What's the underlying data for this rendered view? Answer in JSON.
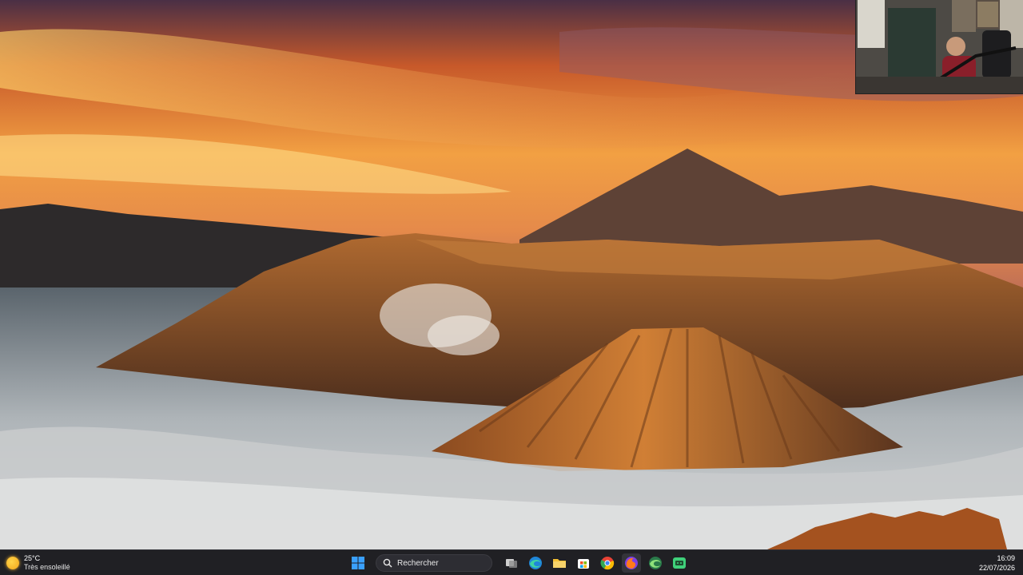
{
  "desktop": {
    "wallpaper": "volcano-sunrise",
    "webcam_overlay": "streamer-webcam"
  },
  "taskbar": {
    "weather": {
      "temperature": "25°C",
      "condition": "Très ensoleillé",
      "icon": "sun-icon"
    },
    "search": {
      "placeholder": "Rechercher",
      "icon": "search-icon"
    },
    "apps": [
      {
        "name": "start-icon",
        "color": "#3aa0ff"
      },
      {
        "name": "task-view-icon",
        "color": "#cfcfcf"
      },
      {
        "name": "edge-icon",
        "color": "#2db3a6"
      },
      {
        "name": "file-explorer-icon",
        "color": "#f5c033"
      },
      {
        "name": "microsoft-store-icon",
        "color": "#ffffff"
      },
      {
        "name": "chrome-icon",
        "color": "#e94235"
      },
      {
        "name": "firefox-icon",
        "color": "#ff7a1a"
      },
      {
        "name": "edge-dev-icon",
        "color": "#4bb96a"
      },
      {
        "name": "terminal-app-icon",
        "color": "#3fd07a"
      }
    ],
    "clock": {
      "time": "16:09",
      "date": "22/07/2026"
    }
  }
}
